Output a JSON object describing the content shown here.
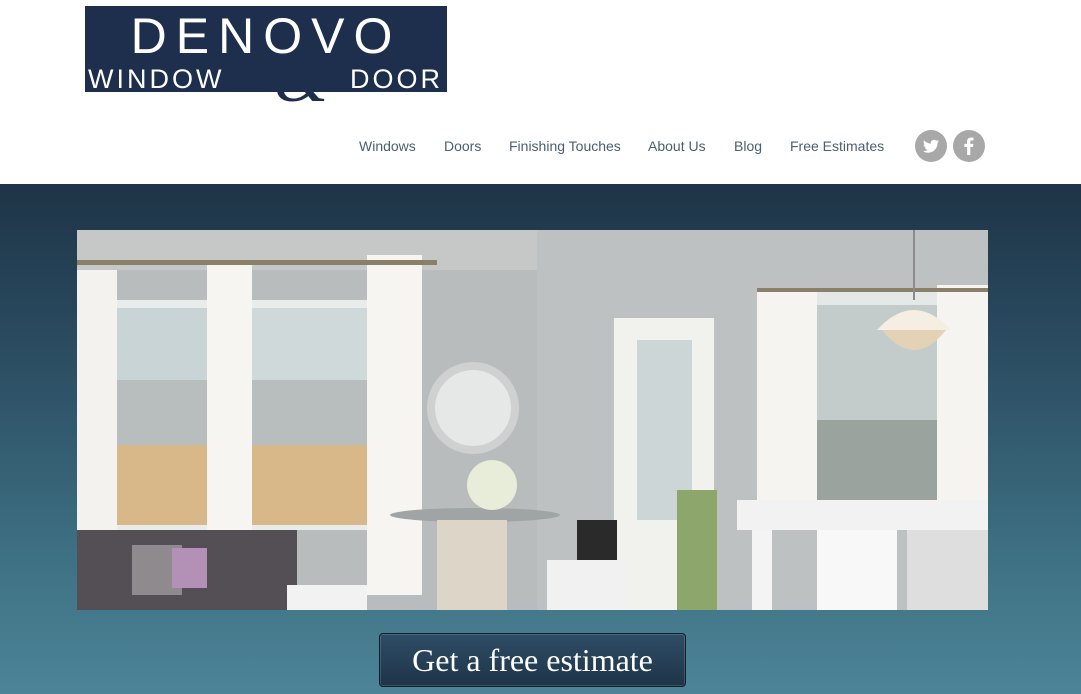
{
  "logo": {
    "top": "DENOVO",
    "left": "WINDOW",
    "amp": "&",
    "right": "DOOR"
  },
  "nav": {
    "items": [
      {
        "label": "Windows"
      },
      {
        "label": "Doors"
      },
      {
        "label": "Finishing Touches"
      },
      {
        "label": "About Us"
      },
      {
        "label": "Blog"
      },
      {
        "label": "Free Estimates"
      }
    ]
  },
  "social": [
    {
      "icon": "twitter-icon",
      "glyph": "t"
    },
    {
      "icon": "facebook-icon",
      "glyph": "f"
    }
  ],
  "hero": {
    "cta_label": "Get a free estimate"
  },
  "colors": {
    "brand_navy": "#1d2f4d",
    "nav_text": "#4a6070",
    "hero_top": "#1e3447",
    "hero_bottom": "#4d8497"
  }
}
